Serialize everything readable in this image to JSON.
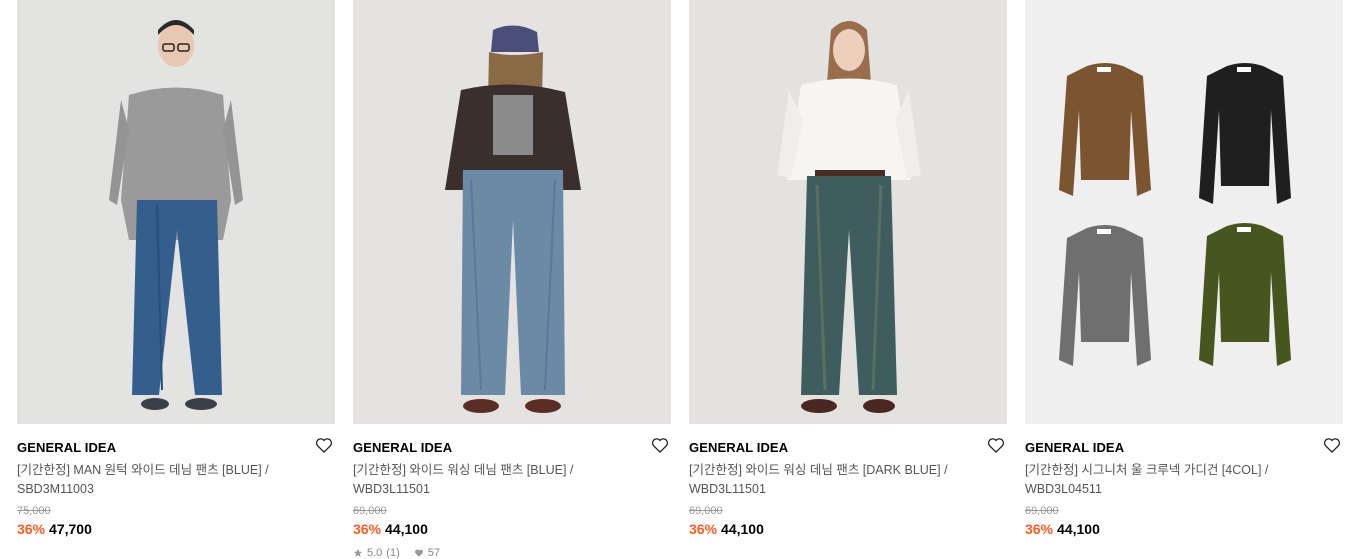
{
  "products": [
    {
      "brand": "GENERAL IDEA",
      "title": "[기간한정] MAN 원턱 와이드 데님 팬츠 [BLUE] / SBD3M11003",
      "original_price": "75,000",
      "discount": "36%",
      "price": "47,700",
      "photo_icon": "model-man-denim-photo"
    },
    {
      "brand": "GENERAL IDEA",
      "title": "[기간한정] 와이드 워싱 데님 팬츠 [BLUE] / WBD3L11501",
      "original_price": "69,000",
      "discount": "36%",
      "price": "44,100",
      "rating": "5.0",
      "rating_count": "(1)",
      "likes": "57",
      "photo_icon": "model-woman-cap-denim-photo"
    },
    {
      "brand": "GENERAL IDEA",
      "title": "[기간한정] 와이드 워싱 데님 팬츠 [DARK BLUE] / WBD3L11501",
      "original_price": "69,000",
      "discount": "36%",
      "price": "44,100",
      "photo_icon": "model-woman-shirt-denim-photo"
    },
    {
      "brand": "GENERAL IDEA",
      "title": "[기간한정] 시그니처 울 크루넥 가디건 [4COL] / WBD3L04511",
      "original_price": "69,000",
      "discount": "36%",
      "price": "44,100",
      "photo_icon": "cardigan-four-colors-photo"
    }
  ],
  "colors": {
    "discount": "#ff5a1f",
    "strike": "#9a9a9a",
    "title": "#555555"
  }
}
